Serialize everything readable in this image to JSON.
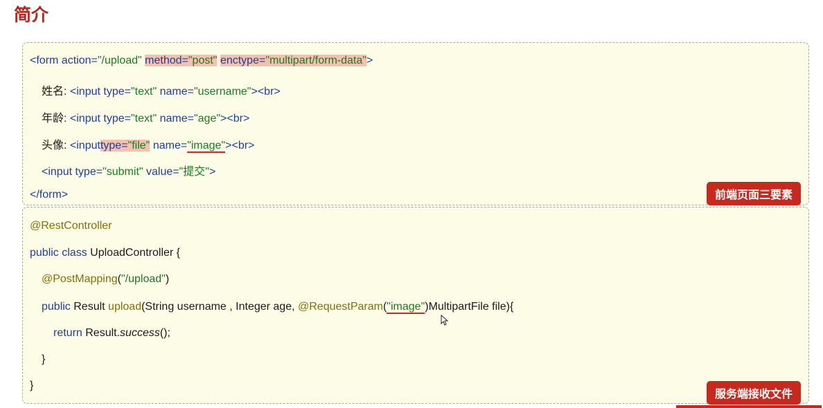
{
  "page": {
    "title": "简介"
  },
  "frontend": {
    "tag": "前端页面三要素",
    "form_open": {
      "lt": "<form ",
      "action_attr": "action=",
      "action_val": "\"/upload\"",
      "method_attr": "method=",
      "method_val": "\"post\"",
      "enctype_attr": "enctype=",
      "enctype_val": "\"multipart/form-data\"",
      "gt": ">"
    },
    "name_row": {
      "label": "姓名: ",
      "lt": "<input ",
      "type_attr": "type=",
      "type_val": "\"text\"",
      "name_attr": "name=",
      "name_val": "\"username\"",
      "tail": "><br>"
    },
    "age_row": {
      "label": "年龄: ",
      "lt": "<input ",
      "type_attr": "type=",
      "type_val": "\"text\"",
      "name_attr": "name=",
      "name_val": "\"age\"",
      "tail": "><br>"
    },
    "avatar_row": {
      "label": "头像: ",
      "lt": "<input",
      "type_attr": "type=",
      "type_val": "\"file\"",
      "name_attr": "name=",
      "name_q1": "\"",
      "name_core": "image",
      "name_q2": "\"",
      "tail": "><br>"
    },
    "submit_row": {
      "lt": "<input ",
      "type_attr": "type=",
      "type_val": "\"submit\"",
      "value_attr": "value=",
      "value_val": "\"提交\"",
      "gt": ">"
    },
    "form_close": "</form>"
  },
  "backend": {
    "tag": "服务端接收文件",
    "annotation_rest": "@RestController",
    "class_decl": {
      "kw": "public class ",
      "name": "UploadController {"
    },
    "post_mapping": {
      "annotation": "@PostMapping",
      "open": "(",
      "path": "\"/upload\"",
      "close": ")"
    },
    "method_decl": {
      "kw": "public ",
      "return_type": "Result ",
      "name": "upload",
      "params": "(String username , Integer age, ",
      "annotation": "@RequestParam",
      "open": "(",
      "q1": "\"",
      "core": "image",
      "q2": "\"",
      "tail": ")MultipartFile file){"
    },
    "return_stmt": {
      "kw": "return ",
      "obj": "Result.",
      "call": "success",
      "tail": "();"
    },
    "close_method": "}",
    "close_class": "}"
  },
  "colors": {
    "title": "#b3281e",
    "panel_bg": "#fdfce6",
    "tag_bg": "#c7291f",
    "keyword": "#1d3f9e",
    "string": "#1c7a26",
    "annotation": "#8a6d05",
    "highlight": "#f6c0ae",
    "underline": "#d2281f"
  }
}
